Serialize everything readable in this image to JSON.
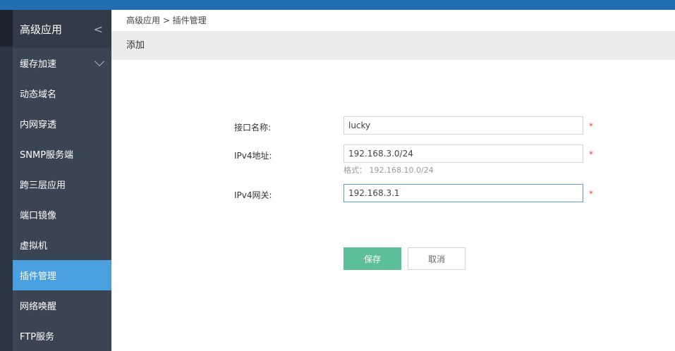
{
  "titlebar": {
    "text": ""
  },
  "sidebar": {
    "header_label": "高级应用",
    "header_chevron": "<",
    "items": [
      {
        "label": "缓存加速",
        "expandable": true,
        "active": false
      },
      {
        "label": "动态域名",
        "expandable": false,
        "active": false
      },
      {
        "label": "内网穿透",
        "expandable": false,
        "active": false
      },
      {
        "label": "SNMP服务端",
        "expandable": false,
        "active": false
      },
      {
        "label": "跨三层应用",
        "expandable": false,
        "active": false
      },
      {
        "label": "端口镜像",
        "expandable": false,
        "active": false
      },
      {
        "label": "虚拟机",
        "expandable": false,
        "active": false
      },
      {
        "label": "插件管理",
        "expandable": false,
        "active": true
      },
      {
        "label": "网络唤醒",
        "expandable": false,
        "active": false
      },
      {
        "label": "FTP服务",
        "expandable": false,
        "active": false
      }
    ],
    "active_color": "#4a9fde"
  },
  "breadcrumb": "高级应用 > 插件管理",
  "section": {
    "title": "添加"
  },
  "form": {
    "name_label": "接口名称:",
    "name_value": "lucky",
    "ipv4_label": "IPv4地址:",
    "ipv4_value": "192.168.3.0/24",
    "ipv4_hint": "格式： 192.168.10.0/24",
    "gateway_label": "IPv4网关:",
    "gateway_value": "192.168.3.1",
    "required_mark": "*"
  },
  "buttons": {
    "save": "保存",
    "cancel": "取消"
  },
  "colors": {
    "save_button": "#5dbf9a",
    "required": "#e24a3b",
    "titlebar": "#1f6fb2"
  }
}
